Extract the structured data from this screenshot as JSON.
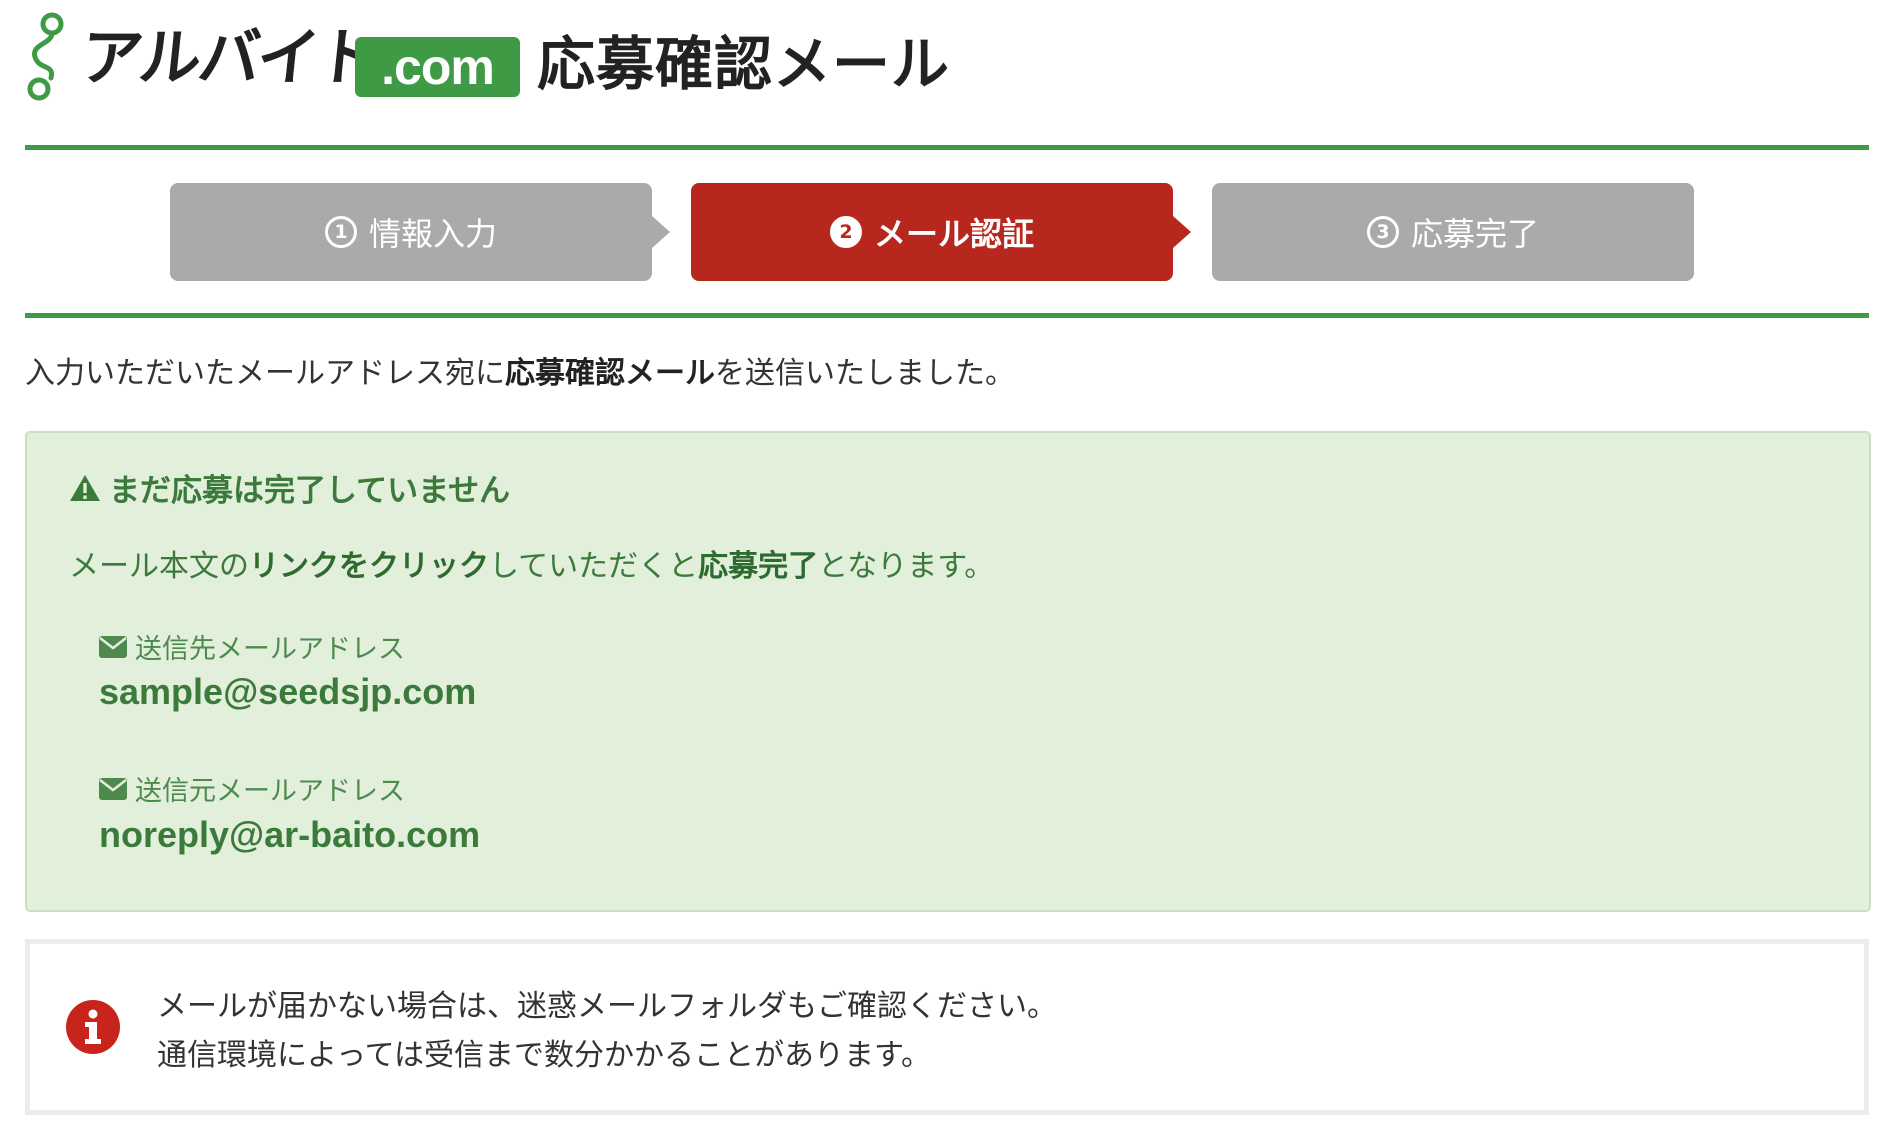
{
  "header": {
    "logo_text": "アルバイト",
    "logo_com": ".com",
    "title": "応募確認メール"
  },
  "steps": [
    {
      "number": "1",
      "label": "情報入力",
      "active": false
    },
    {
      "number": "2",
      "label": "メール認証",
      "active": true
    },
    {
      "number": "3",
      "label": "応募完了",
      "active": false
    }
  ],
  "intro": {
    "before": "入力いただいたメールアドレス宛に",
    "bold": "応募確認メール",
    "after": "を送信いたしました。"
  },
  "notice": {
    "title": "まだ応募は完了していません",
    "body_1": "メール本文の",
    "body_bold_1": "リンクをクリック",
    "body_2": "していただくと",
    "body_bold_2": "応募完了",
    "body_3": "となります。",
    "to_label": "送信先メールアドレス",
    "to_value": "sample@seedsjp.com",
    "from_label": "送信元メールアドレス",
    "from_value": "noreply@ar-baito.com"
  },
  "info": {
    "line1": "メールが届かない場合は、迷惑メールフォルダもご確認ください。",
    "line2": "通信環境によっては受信まで数分かかることがあります。"
  },
  "colors": {
    "brand_green": "#3e9a44",
    "active_step": "#b8271e",
    "inactive_step": "#aaaaaa",
    "notice_bg": "#e1efdb",
    "notice_text": "#3b7a3b",
    "info_icon": "#c8241b"
  },
  "icons": {
    "logo_mark": "key-chain-icon",
    "warning": "warning-triangle-icon",
    "mail": "envelope-icon",
    "info": "info-circle-icon"
  }
}
